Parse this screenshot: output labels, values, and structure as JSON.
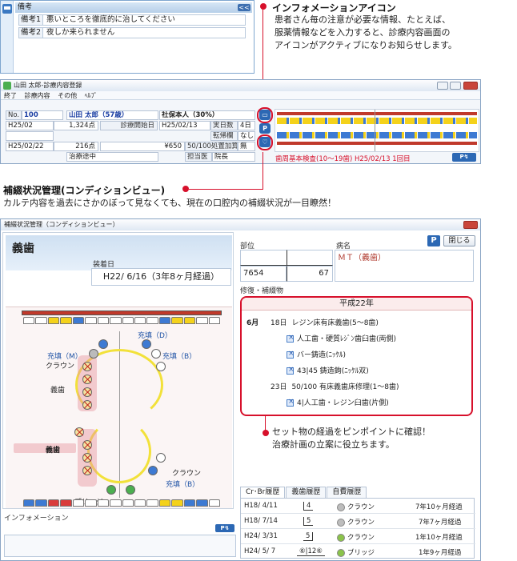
{
  "memo": {
    "title": "備考",
    "collapse_glyph": "<<",
    "rows": [
      {
        "key": "備考1",
        "value": "悪いところを徹底的に治してください"
      },
      {
        "key": "備考2",
        "value": "夜しか来られません"
      }
    ]
  },
  "callout_info": {
    "title": "インフォメーションアイコン",
    "body": [
      "患者さん毎の注意が必要な情報、たとえば、",
      "服薬情報などを入力すると、診療内容画面の",
      "アイコンがアクティブになりお知らせします。"
    ]
  },
  "callout_condition": {
    "title": "補綴状況管理(コンディションビュー)",
    "body": "カルテ内容を過去にさかのぼって見なくても、現在の口腔内の補綴状況が一目瞭然！"
  },
  "callout_history": {
    "body": [
      "セット物の経過をピンポイントに確認！",
      "治療計画の立案に役立ちます。"
    ]
  },
  "regwin": {
    "title": "山田 太郎-診療内容登録",
    "menu": [
      "終了",
      "診療内容",
      "その他",
      "ﾍﾙﾌﾟ"
    ],
    "no_label": "No.",
    "no_value": "100",
    "patient": "山田 太郎（57歳）",
    "insurance": "社保本人（30%）",
    "row2": {
      "date": "H25/02",
      "points": "1,324点",
      "start_label": "診療開始日",
      "start_value": "H25/02/13",
      "days_label": "実日数",
      "days_value": "4日",
      "transfer_label": "転帰欄",
      "transfer_value": "なし"
    },
    "row3": {
      "date": "H25/02/22",
      "points": "216点",
      "yen": "¥650",
      "rate_label": "50/100処置加算",
      "rate_value": "無"
    },
    "row4": {
      "status": "治療途中",
      "doctor_label": "担当医",
      "doctor_value": "院長"
    },
    "exam": "歯周基本検査(10〜19歯) H25/02/13 1回目"
  },
  "cvwin": {
    "title": "補綴状況管理（コンディションビュー）",
    "section": "義歯",
    "mount_label": "装着日",
    "mount_value": "H22/ 6/16（3年8ヶ月経過）",
    "annotations": {
      "fill_d": "充填（D）",
      "fill_m": "充填（M）",
      "fill_b": "充填（B）",
      "crown": "クラウン",
      "gishi": "義歯",
      "gishi2": "義歯",
      "crown2": "クラウン",
      "fill_b2": "充填（B）",
      "bridge": "ブリッジ"
    },
    "part_label": "部位",
    "disease_label": "病名",
    "part_value": "7654",
    "part_value2": "67",
    "disease_value": "ＭＴ（義歯）",
    "close_label": "閉じる",
    "history_label": "修復・補綴物",
    "year": "平成22年",
    "month": "6月",
    "entries": [
      {
        "day": "18日",
        "text": "レジン床有床義歯(5〜8歯)"
      },
      {
        "day": "",
        "text": "人工歯・硬質ﾚｼﾞﾝ歯臼歯(両側)"
      },
      {
        "day": "",
        "text": "バー鋳造(ﾆｯｹﾙ)"
      },
      {
        "day": "",
        "text": "43|45 鋳造鉤(ﾆｯｹﾙ双)"
      },
      {
        "day": "23日",
        "text": "50/100 有床義歯床修理(1〜8歯)"
      },
      {
        "day": "",
        "text": "4|人工歯・レジン臼歯(片側)"
      }
    ],
    "tabs": [
      "Cr･Br履歴",
      "義歯履歴",
      "自費履歴"
    ],
    "rows": [
      {
        "date": "H18/ 4/11",
        "tooth": "4",
        "type": "クラウン",
        "elapsed": "7年10ヶ月経過",
        "color": "#bdbdbd"
      },
      {
        "date": "H18/ 7/14",
        "tooth": "5",
        "type": "クラウン",
        "elapsed": "7年7ヶ月経過",
        "color": "#bdbdbd"
      },
      {
        "date": "H24/ 3/31",
        "tooth": "5",
        "type": "クラウン",
        "elapsed": "1年10ヶ月経過",
        "color": "#8bc34a"
      },
      {
        "date": "H24/ 5/ 7",
        "tooth": "⑥|12⑥",
        "type": "ブリッジ",
        "elapsed": "1年9ヶ月経過",
        "color": "#8bc34a"
      }
    ],
    "info_label": "インフォメーション",
    "logo": "P"
  }
}
